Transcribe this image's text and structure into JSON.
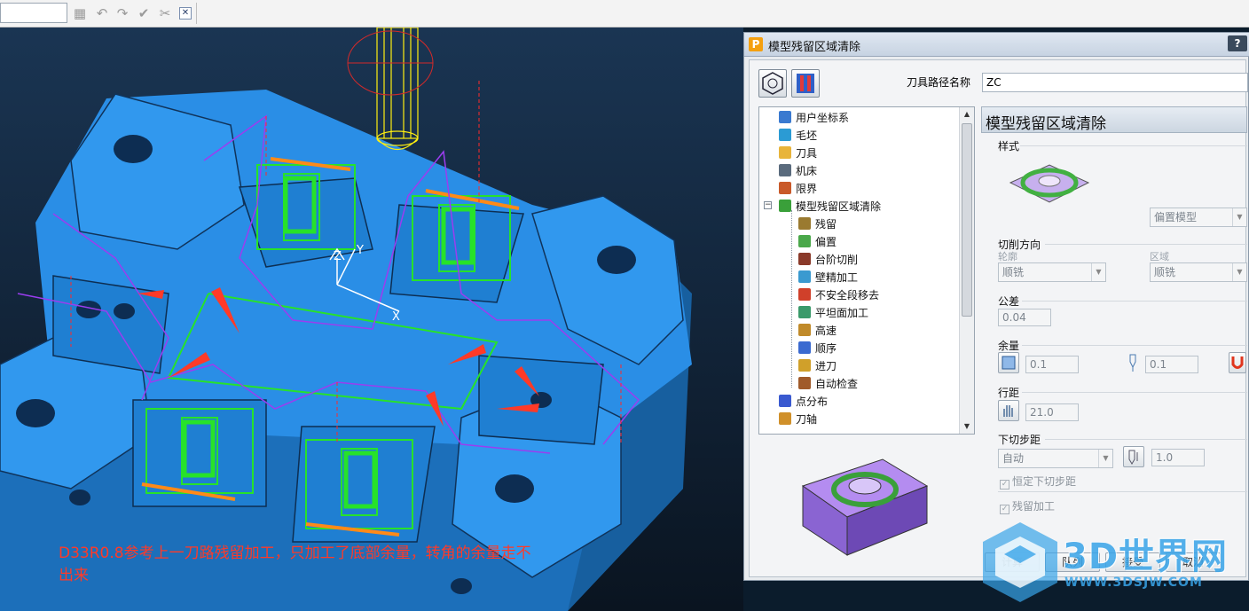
{
  "toolbar": {
    "input_value": "",
    "icons": [
      "calculator-icon",
      "undo-icon",
      "redo-icon",
      "check-icon",
      "scissors-icon",
      "close-icon"
    ]
  },
  "viewport": {
    "annotation_line1": "D33R0.8参考上一刀路残留加工，只加工了底部余量，转角的余量走不",
    "annotation_line2": "出来",
    "axis_x": "X",
    "axis_y": "Y",
    "axis_z": "Z"
  },
  "dialog": {
    "title": "模型残留区域清除",
    "help": "?",
    "toolpath_name_label": "刀具路径名称",
    "toolpath_name_value": "ZC",
    "tree": [
      {
        "label": "用户坐标系",
        "icon": "ucs-icon",
        "indent": 0
      },
      {
        "label": "毛坯",
        "icon": "block-icon",
        "indent": 0
      },
      {
        "label": "刀具",
        "icon": "tool-icon",
        "indent": 0
      },
      {
        "label": "机床",
        "icon": "machine-icon",
        "indent": 0
      },
      {
        "label": "限界",
        "icon": "limits-icon",
        "indent": 0
      },
      {
        "label": "模型残留区域清除",
        "icon": "strategy-icon",
        "indent": 0
      },
      {
        "label": "残留",
        "icon": "rest-icon",
        "indent": 1
      },
      {
        "label": "偏置",
        "icon": "offset-icon",
        "indent": 1
      },
      {
        "label": "台阶切削",
        "icon": "step-cut-icon",
        "indent": 1
      },
      {
        "label": "壁精加工",
        "icon": "wall-finish-icon",
        "indent": 1
      },
      {
        "label": "不安全段移去",
        "icon": "unsafe-remove-icon",
        "indent": 1
      },
      {
        "label": "平坦面加工",
        "icon": "flat-face-icon",
        "indent": 1
      },
      {
        "label": "高速",
        "icon": "high-speed-icon",
        "indent": 1
      },
      {
        "label": "顺序",
        "icon": "order-icon",
        "indent": 1
      },
      {
        "label": "进刀",
        "icon": "lead-in-icon",
        "indent": 1
      },
      {
        "label": "自动检查",
        "icon": "auto-check-icon",
        "indent": 1
      },
      {
        "label": "点分布",
        "icon": "point-dist-icon",
        "indent": 0
      },
      {
        "label": "刀轴",
        "icon": "tool-axis-icon",
        "indent": 0
      }
    ],
    "panel_title": "模型残留区域清除",
    "style_label": "样式",
    "style_value": "偏置模型",
    "cut_direction_label": "切削方向",
    "profile_label": "轮廓",
    "profile_value": "顺铣",
    "area_label": "区域",
    "area_value": "顺铣",
    "tolerance_label": "公差",
    "tolerance_value": "0.04",
    "allowance_label": "余量",
    "allowance_value1": "0.1",
    "allowance_value2": "0.1",
    "stepover_label": "行距",
    "stepover_value": "21.0",
    "stepdown_label": "下切步距",
    "stepdown_mode": "自动",
    "stepdown_value": "1.0",
    "constant_stepdown_label": "恒定下切步距",
    "rest_machining_label": "残留加工",
    "buttons": [
      "计算",
      "队列",
      "接受",
      "取消"
    ]
  },
  "watermark": {
    "text": "3D世界网",
    "url": "WWW.3DSJW.COM"
  },
  "colors": {
    "part_blue": "#2a8ee6",
    "toolpath_green": "#27e22a",
    "arrow_red": "#ff3a28",
    "accent_purple": "#9b3df0",
    "tool_yellow": "#ffef10"
  }
}
